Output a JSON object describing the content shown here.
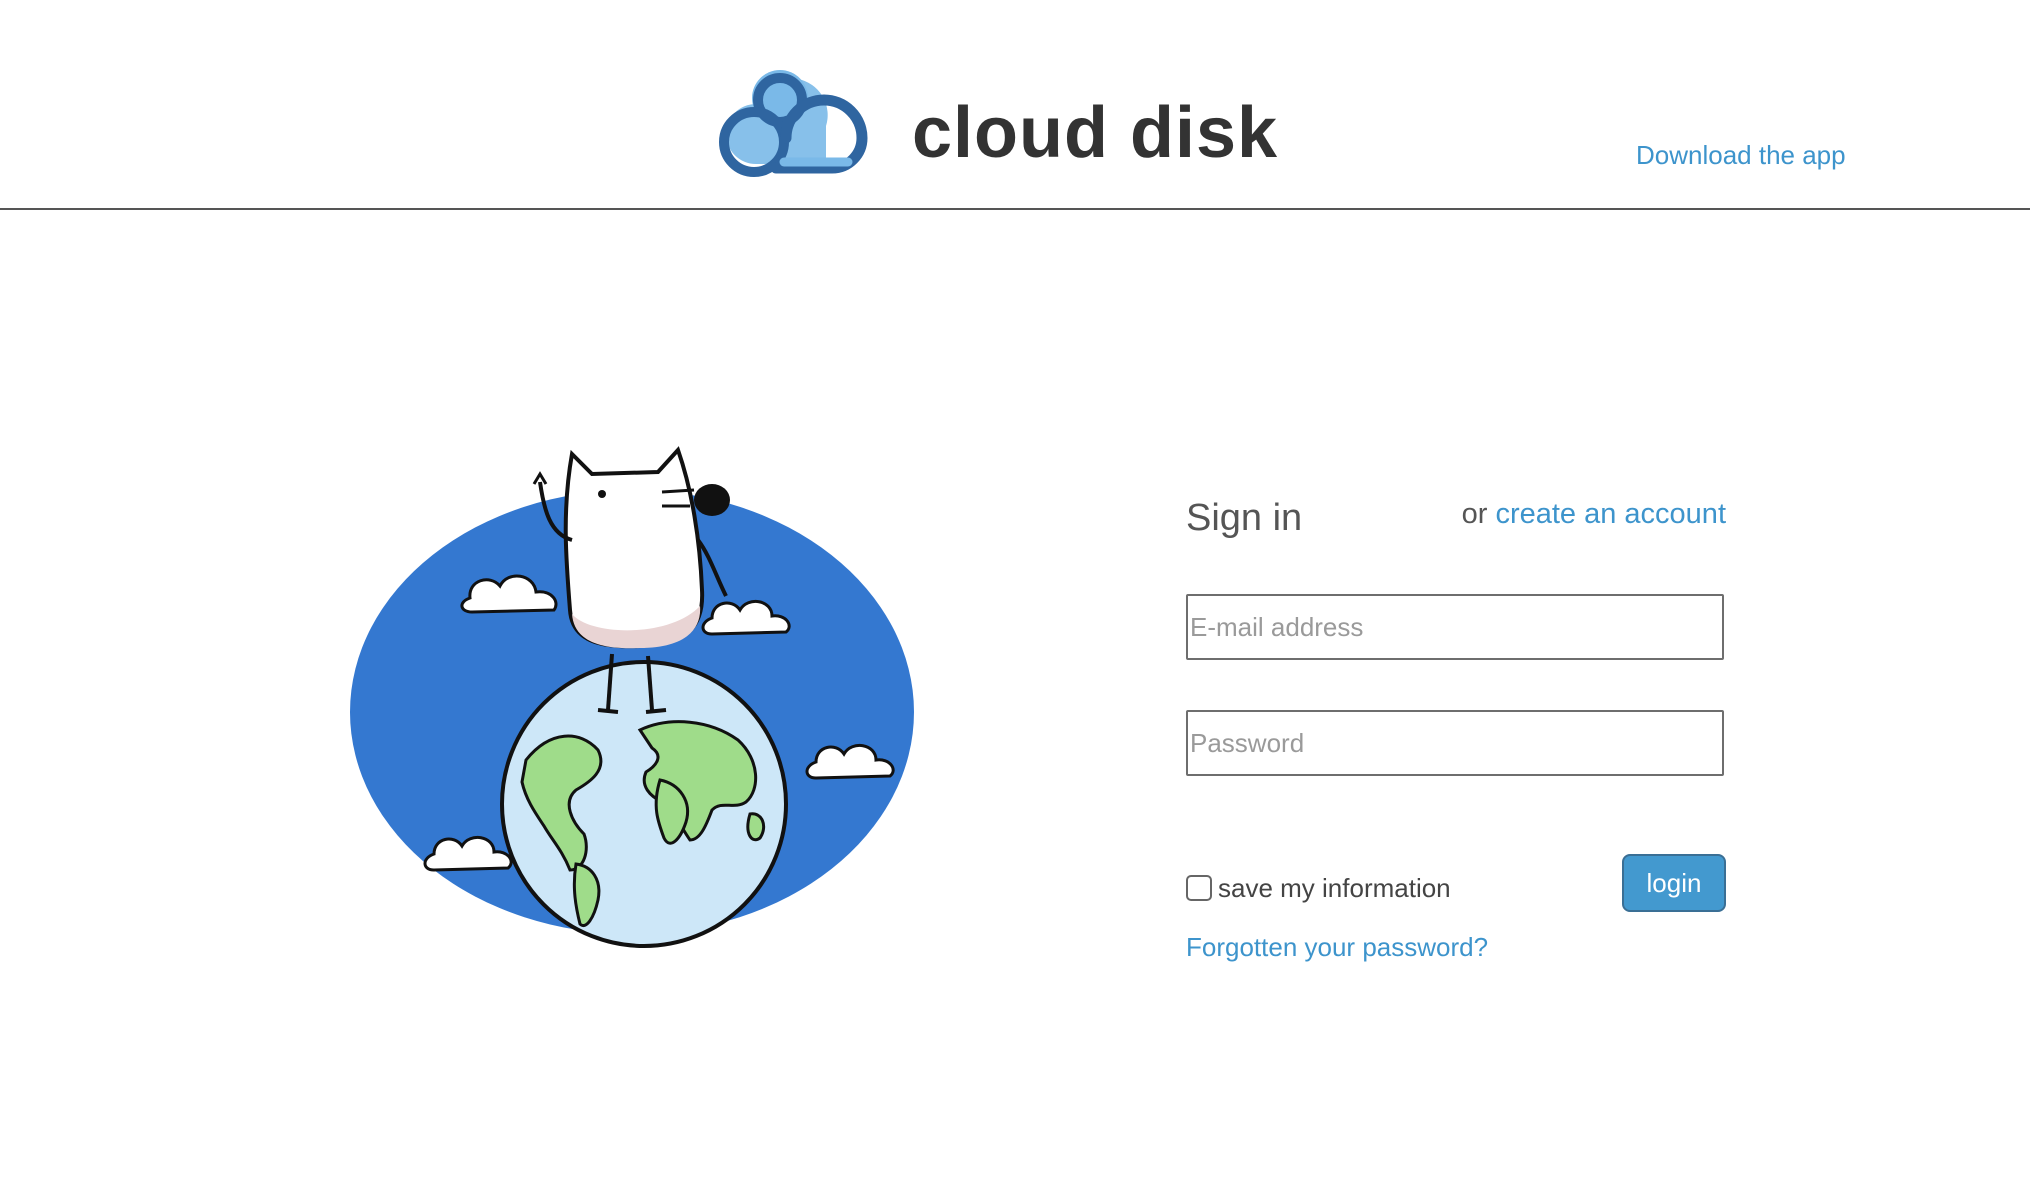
{
  "header": {
    "logo_icon": "cloud-logo-icon",
    "app_name": "cloud disk",
    "download_link": "Download the app"
  },
  "illustration": {
    "name": "dog-on-globe-illustration"
  },
  "signin": {
    "title": "Sign in",
    "or_text": "or ",
    "create_account_link": "create an account",
    "email_placeholder": "E-mail address",
    "email_value": "",
    "password_placeholder": "Password",
    "password_value": "",
    "remember_label": "save my information",
    "remember_checked": false,
    "login_button": "login",
    "forgot_link": "Forgotten your password?"
  },
  "colors": {
    "accent": "#3d94cc",
    "button": "#4399cf",
    "text_dark": "#333333",
    "sky_blue": "#3478d0",
    "ocean_light": "#cde7f8",
    "land_green": "#9fdc8a",
    "logo_dark": "#2f65a0",
    "logo_light": "#7ab9e8"
  }
}
